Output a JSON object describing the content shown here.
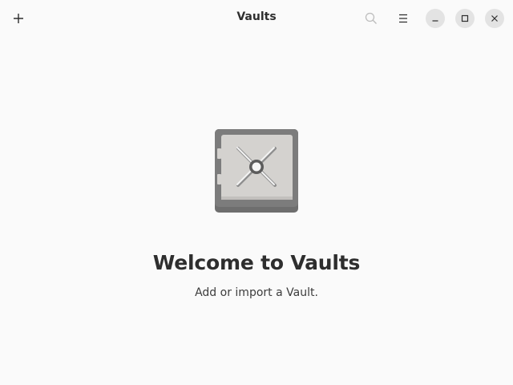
{
  "headerbar": {
    "title": "Vaults",
    "buttons": [
      {
        "name": "add",
        "icon": "plus-icon"
      },
      {
        "name": "search",
        "icon": "search-icon"
      },
      {
        "name": "main-menu",
        "icon": "hamburger-icon"
      }
    ],
    "window_controls": [
      {
        "name": "minimize",
        "icon": "minimize-icon"
      },
      {
        "name": "maximize",
        "icon": "maximize-icon"
      },
      {
        "name": "close",
        "icon": "close-icon"
      }
    ]
  },
  "status_page": {
    "icon": "vault-safe-icon",
    "title": "Welcome to Vaults",
    "description": "Add or import a Vault."
  },
  "colors": {
    "background": "#fafafa",
    "window_control_bg": "#e3e3e3",
    "vault_body": "#787878",
    "vault_door": "#d4d2cf"
  }
}
